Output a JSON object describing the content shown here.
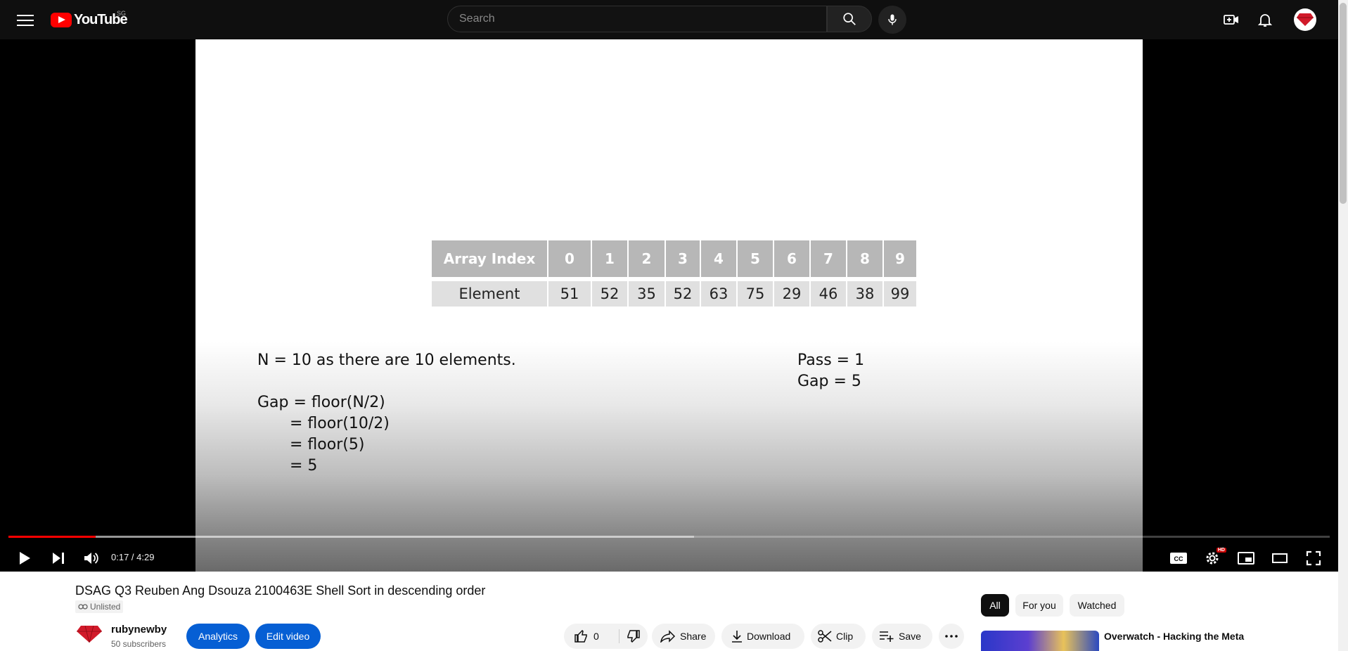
{
  "header": {
    "logo_text": "YouTube",
    "country_code": "SG",
    "search_placeholder": "Search"
  },
  "player": {
    "slide": {
      "table": {
        "header_label": "Array Index",
        "row_label": "Element",
        "indices": [
          "0",
          "1",
          "2",
          "3",
          "4",
          "5",
          "6",
          "7",
          "8",
          "9"
        ],
        "elements": [
          "51",
          "52",
          "35",
          "52",
          "63",
          "75",
          "29",
          "46",
          "38",
          "99"
        ]
      },
      "n_line": "N = 10 as there are 10 elements.",
      "gap_lines": [
        "Gap = floor(N/2)",
        "= floor(10/2)",
        "= floor(5)",
        "= 5"
      ],
      "pass_line": "Pass = 1",
      "gap_value_line": "Gap = 5"
    },
    "time_display": "0:17 / 4:29",
    "progress_played_fraction": 0.066,
    "progress_loaded_fraction": 0.519,
    "hd_badge": "HD"
  },
  "video": {
    "title": "DSAG Q3 Reuben Ang Dsouza 2100463E Shell Sort in descending order",
    "visibility": "Unlisted",
    "channel_name": "rubynewby",
    "subscribers": "50 subscribers",
    "analytics_label": "Analytics",
    "edit_label": "Edit video",
    "like_count": "0",
    "share_label": "Share",
    "download_label": "Download",
    "clip_label": "Clip",
    "save_label": "Save"
  },
  "recommendations": {
    "chips": [
      "All",
      "For you",
      "Watched"
    ],
    "first_title": "Overwatch - Hacking the Meta"
  },
  "colors": {
    "brand_red": "#ff0000",
    "accent_blue": "#065fd4",
    "topbar_bg": "#0f0f0f"
  }
}
